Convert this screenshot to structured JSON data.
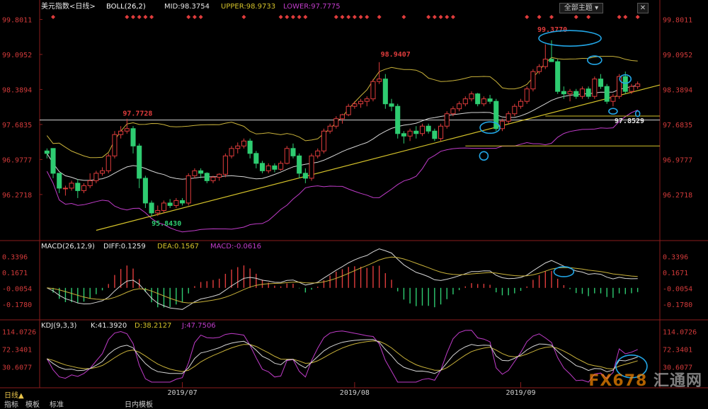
{
  "header": {
    "title": "美元指数<日线>",
    "indicator": "BOLL(26,2)",
    "mid": "MID:98.3754",
    "upper": "UPPER:98.9733",
    "lower": "LOWER:97.7775",
    "dropdown_label": "全部主题",
    "close_label": "✕"
  },
  "colors": {
    "background": "#000000",
    "up": "#e03c3c",
    "down": "#2ecc71",
    "mid_line": "#d6d6d6",
    "upper_line": "#c9b23a",
    "lower_line": "#c03cc9",
    "trend_line": "#d4c22a",
    "axis_text": "#d23a3a",
    "circle": "#22a6e6"
  },
  "chart_data": [
    {
      "name": "price",
      "type": "candlestick",
      "y_ticks": [
        "99.8011",
        "99.0952",
        "98.3894",
        "97.6835",
        "96.9777",
        "96.2718"
      ],
      "ylim": [
        95.4,
        100.05
      ],
      "annotations": [
        {
          "label": "97.7728",
          "value": 97.7728
        },
        {
          "label": "95.8430",
          "value": 95.843
        },
        {
          "label": "98.9407",
          "value": 98.9407
        },
        {
          "label": "99.3770",
          "value": 99.377
        },
        {
          "label": "97.8529",
          "value": 97.8529
        }
      ],
      "candles": [
        [
          97.15,
          97.2,
          97.0,
          97.1
        ],
        [
          97.2,
          97.1,
          96.6,
          96.7
        ],
        [
          96.7,
          96.6,
          96.3,
          96.4
        ],
        [
          96.4,
          96.45,
          96.25,
          96.4
        ],
        [
          96.4,
          96.55,
          96.35,
          96.5
        ],
        [
          96.5,
          96.58,
          96.2,
          96.35
        ],
        [
          96.35,
          96.5,
          96.3,
          96.45
        ],
        [
          96.45,
          96.7,
          96.4,
          96.55
        ],
        [
          96.55,
          96.75,
          96.5,
          96.7
        ],
        [
          96.7,
          96.82,
          96.65,
          96.75
        ],
        [
          96.75,
          97.1,
          96.7,
          97.05
        ],
        [
          97.05,
          97.55,
          97.0,
          97.48
        ],
        [
          97.48,
          97.65,
          97.4,
          97.55
        ],
        [
          97.55,
          97.8,
          97.5,
          97.6
        ],
        [
          97.6,
          97.65,
          97.1,
          97.25
        ],
        [
          97.25,
          97.3,
          96.4,
          96.6
        ],
        [
          96.6,
          96.65,
          96.0,
          96.1
        ],
        [
          96.1,
          96.15,
          95.84,
          95.9
        ],
        [
          95.9,
          96.05,
          95.84,
          95.95
        ],
        [
          95.95,
          96.15,
          95.9,
          96.1
        ],
        [
          96.1,
          96.18,
          96.0,
          96.05
        ],
        [
          96.05,
          96.2,
          96.0,
          96.15
        ],
        [
          96.15,
          96.2,
          96.05,
          96.1
        ],
        [
          96.1,
          96.7,
          96.05,
          96.65
        ],
        [
          96.65,
          96.8,
          96.6,
          96.75
        ],
        [
          96.75,
          96.8,
          96.6,
          96.7
        ],
        [
          96.7,
          96.72,
          96.5,
          96.55
        ],
        [
          96.55,
          96.65,
          96.5,
          96.62
        ],
        [
          96.62,
          96.7,
          96.55,
          96.68
        ],
        [
          96.68,
          97.1,
          96.62,
          97.05
        ],
        [
          97.05,
          97.25,
          97.0,
          97.2
        ],
        [
          97.2,
          97.32,
          97.1,
          97.25
        ],
        [
          97.25,
          97.4,
          97.2,
          97.35
        ],
        [
          97.35,
          97.4,
          97.0,
          97.1
        ],
        [
          97.1,
          97.15,
          96.8,
          96.9
        ],
        [
          96.9,
          96.95,
          96.7,
          96.75
        ],
        [
          96.75,
          96.9,
          96.7,
          96.85
        ],
        [
          96.85,
          96.9,
          96.72,
          96.78
        ],
        [
          96.78,
          96.95,
          96.75,
          96.9
        ],
        [
          96.9,
          97.25,
          96.88,
          97.2
        ],
        [
          97.2,
          97.3,
          97.0,
          97.05
        ],
        [
          97.05,
          97.1,
          96.6,
          96.7
        ],
        [
          96.7,
          96.8,
          96.5,
          96.6
        ],
        [
          96.6,
          97.1,
          96.55,
          97.05
        ],
        [
          97.05,
          97.2,
          97.0,
          97.15
        ],
        [
          97.15,
          97.6,
          97.1,
          97.55
        ],
        [
          97.55,
          97.7,
          97.5,
          97.65
        ],
        [
          97.65,
          97.85,
          97.6,
          97.8
        ],
        [
          97.8,
          97.9,
          97.7,
          97.88
        ],
        [
          97.88,
          98.1,
          97.85,
          98.05
        ],
        [
          98.05,
          98.15,
          98.0,
          98.1
        ],
        [
          98.1,
          98.2,
          98.02,
          98.15
        ],
        [
          98.15,
          98.25,
          98.05,
          98.2
        ],
        [
          98.2,
          98.6,
          98.15,
          98.55
        ],
        [
          98.55,
          98.94,
          98.5,
          98.6
        ],
        [
          98.6,
          98.7,
          98.0,
          98.1
        ],
        [
          98.1,
          98.2,
          97.95,
          98.05
        ],
        [
          98.05,
          98.1,
          97.4,
          97.5
        ],
        [
          97.5,
          97.55,
          97.3,
          97.45
        ],
        [
          97.45,
          97.6,
          97.35,
          97.55
        ],
        [
          97.55,
          97.65,
          97.4,
          97.5
        ],
        [
          97.5,
          97.7,
          97.45,
          97.65
        ],
        [
          97.65,
          97.7,
          97.5,
          97.55
        ],
        [
          97.55,
          97.6,
          97.35,
          97.4
        ],
        [
          97.4,
          97.7,
          97.35,
          97.65
        ],
        [
          97.65,
          97.95,
          97.6,
          97.9
        ],
        [
          97.9,
          98.05,
          97.85,
          98.0
        ],
        [
          98.0,
          98.15,
          97.95,
          98.1
        ],
        [
          98.1,
          98.25,
          98.05,
          98.2
        ],
        [
          98.2,
          98.35,
          98.15,
          98.3
        ],
        [
          98.3,
          98.32,
          98.05,
          98.1
        ],
        [
          98.1,
          98.25,
          98.05,
          98.2
        ],
        [
          98.2,
          98.28,
          98.1,
          98.15
        ],
        [
          98.15,
          98.2,
          97.55,
          97.6
        ],
        [
          97.6,
          97.8,
          97.55,
          97.75
        ],
        [
          97.75,
          97.95,
          97.7,
          97.9
        ],
        [
          97.9,
          98.1,
          97.85,
          98.05
        ],
        [
          98.05,
          98.2,
          98.0,
          98.15
        ],
        [
          98.15,
          98.45,
          98.1,
          98.4
        ],
        [
          98.4,
          98.8,
          98.35,
          98.75
        ],
        [
          98.75,
          98.9,
          98.7,
          98.85
        ],
        [
          98.85,
          99.3,
          98.8,
          99.0
        ],
        [
          99.0,
          99.38,
          98.95,
          98.95
        ],
        [
          98.95,
          99.0,
          98.3,
          98.35
        ],
        [
          98.35,
          98.45,
          98.2,
          98.3
        ],
        [
          98.3,
          98.4,
          98.15,
          98.35
        ],
        [
          98.35,
          98.4,
          98.2,
          98.25
        ],
        [
          98.25,
          98.45,
          98.2,
          98.4
        ],
        [
          98.4,
          98.45,
          98.2,
          98.25
        ],
        [
          98.25,
          98.65,
          98.2,
          98.6
        ],
        [
          98.6,
          98.7,
          98.4,
          98.45
        ],
        [
          98.45,
          98.5,
          98.1,
          98.15
        ],
        [
          98.15,
          98.3,
          98.05,
          98.25
        ],
        [
          98.25,
          98.7,
          98.2,
          98.65
        ],
        [
          98.65,
          98.75,
          98.3,
          98.35
        ],
        [
          98.35,
          98.5,
          98.3,
          98.45
        ],
        [
          98.45,
          98.55,
          98.4,
          98.5
        ]
      ]
    },
    {
      "name": "macd",
      "type": "bar+line",
      "title": "MACD(26,12,9)",
      "diff": "DIFF:0.1259",
      "dea": "DEA:0.1567",
      "macd": "MACD:-0.0616",
      "y_ticks": [
        "0.3396",
        "0.1671",
        "-0.0054",
        "-0.1780"
      ],
      "ylim": [
        -0.3,
        0.42
      ]
    },
    {
      "name": "kdj",
      "type": "line",
      "title": "KDJ(9,3,3)",
      "k": "K:41.3920",
      "d": "D:38.2127",
      "j": "J:47.7506",
      "y_ticks": [
        "114.0726",
        "72.3401",
        "30.6077"
      ],
      "ylim": [
        -5,
        125
      ]
    }
  ],
  "xaxis": {
    "months": [
      {
        "label": "2019/07",
        "index": 22
      },
      {
        "label": "2019/08",
        "index": 50
      },
      {
        "label": "2019/09",
        "index": 77
      }
    ]
  },
  "bottom": {
    "tab1": "日线",
    "tab1_arrow": "▲",
    "tab2": "指标",
    "tab3": "模板",
    "tab4": "标准",
    "tab5": "日内模板"
  },
  "watermark": {
    "brand": "FX678",
    "cn": "汇通网"
  }
}
